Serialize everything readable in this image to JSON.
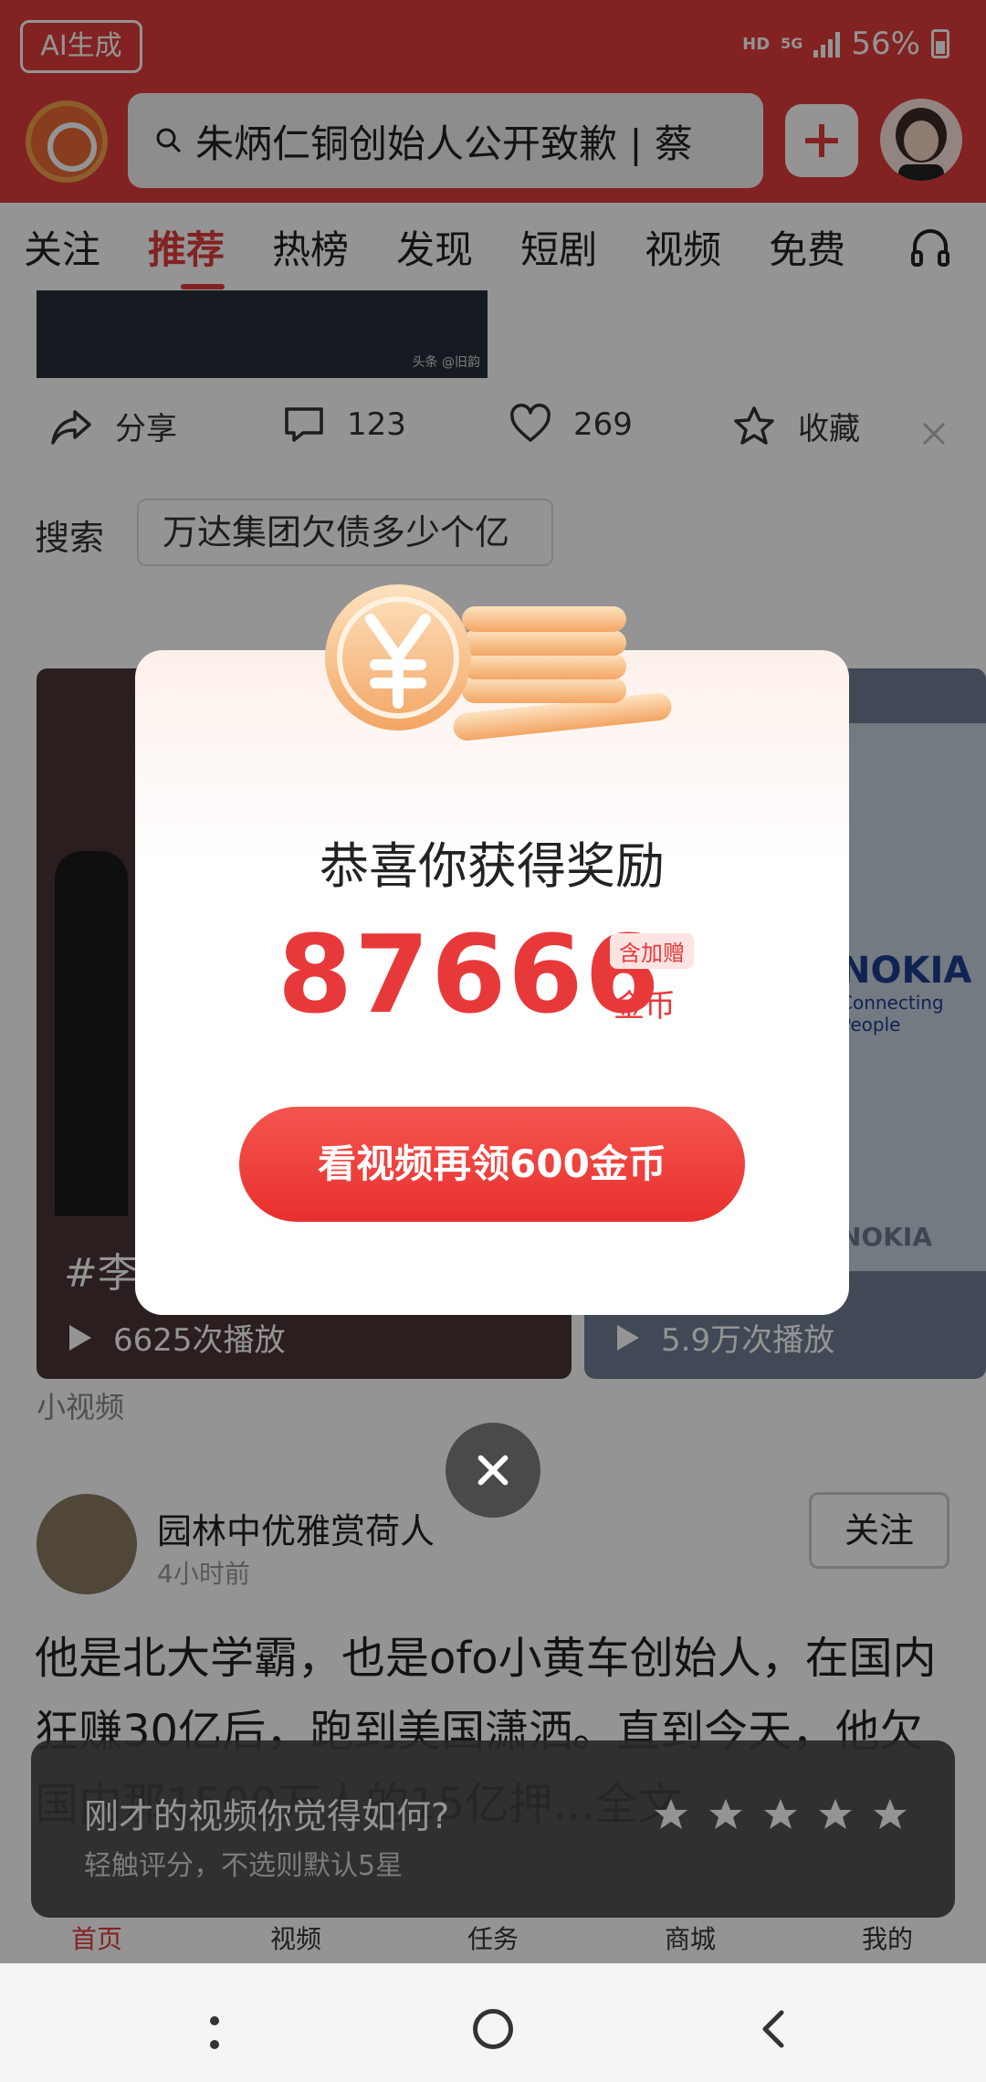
{
  "status_bar": {
    "ai_badge": "AI生成",
    "hd": "HD",
    "network": "5G",
    "battery": "56%"
  },
  "header": {
    "search_text": "朱炳仁铜创始人公开致歉 | 蔡"
  },
  "tabs": [
    "关注",
    "推荐",
    "热榜",
    "发现",
    "短剧",
    "视频",
    "免费"
  ],
  "top_image": {
    "caption": "头条 @旧韵"
  },
  "actions": {
    "share": "分享",
    "comments": "123",
    "likes": "269",
    "favorite": "收藏"
  },
  "search_suggestion": {
    "label": "搜索",
    "query": "万达集团欠债多少个亿"
  },
  "videos": {
    "left": {
      "hashtag": "#李",
      "plays": "6625次播放"
    },
    "right": {
      "brand": "NOKIA",
      "brand_sub": "Connecting People",
      "brand_bottom": "NOKIA",
      "plays": "5.9万次播放"
    }
  },
  "small_video_label": "小视频",
  "post": {
    "author": "园林中优雅赏荷人",
    "time": "4小时前",
    "follow": "关注",
    "text": "他是北大学霸，也是ofo小黄车创始人，在国内狂赚30亿后，跑到美国潇洒。直到今天，他欠国内那1500万人的15亿押...全文"
  },
  "rating": {
    "title": "刚才的视频你觉得如何?",
    "subtitle": "轻触评分，不选则默认5星",
    "stars": 5
  },
  "bottom_nav": [
    "首页",
    "视频",
    "任务",
    "商城",
    "我的"
  ],
  "dialog": {
    "title": "恭喜你获得奖励",
    "amount": "87666",
    "tag": "含加赠",
    "unit": "金币",
    "cta": "看视频再领600金币"
  },
  "colors": {
    "brand_red": "#e23c3c",
    "reward_red": "#e8393a",
    "coin_orange": "#f3a564"
  }
}
